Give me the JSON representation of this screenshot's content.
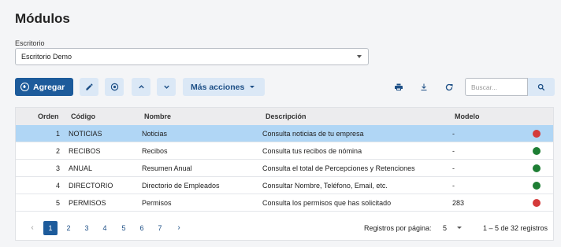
{
  "page": {
    "title": "Módulos"
  },
  "filter": {
    "label": "Escritorio",
    "value": "Escritorio Demo"
  },
  "toolbar": {
    "add_label": "Agregar",
    "more_label": "Más acciones",
    "search_placeholder": "Buscar..."
  },
  "table": {
    "headers": {
      "orden": "Orden",
      "codigo": "Código",
      "nombre": "Nombre",
      "descripcion": "Descripción",
      "modelo": "Modelo"
    },
    "rows": [
      {
        "orden": "1",
        "codigo": "NOTICIAS",
        "nombre": "Noticias",
        "descripcion": "Consulta noticias de tu empresa",
        "modelo": "-",
        "status": "red"
      },
      {
        "orden": "2",
        "codigo": "RECIBOS",
        "nombre": "Recibos",
        "descripcion": "Consulta tus recibos de nómina",
        "modelo": "-",
        "status": "green"
      },
      {
        "orden": "3",
        "codigo": "ANUAL",
        "nombre": "Resumen Anual",
        "descripcion": "Consulta el total de Percepciones y Retenciones",
        "modelo": "-",
        "status": "green"
      },
      {
        "orden": "4",
        "codigo": "DIRECTORIO",
        "nombre": "Directorio de Empleados",
        "descripcion": "Consultar Nombre, Teléfono, Email, etc.",
        "modelo": "-",
        "status": "green"
      },
      {
        "orden": "5",
        "codigo": "PERMISOS",
        "nombre": "Permisos",
        "descripcion": "Consulta los permisos que has solicitado",
        "modelo": "283",
        "status": "red"
      }
    ]
  },
  "colors": {
    "red": "#d43a3a",
    "green": "#1e7e34",
    "accent": "#1d5b9b",
    "selected_row": "#b0d6f5"
  },
  "pagination": {
    "pages": [
      "1",
      "2",
      "3",
      "4",
      "5",
      "6",
      "7"
    ],
    "current": "1",
    "per_page_label": "Registros por página:",
    "per_page_value": "5",
    "range_label": "1 – 5 de 32 registros"
  },
  "icons": [
    "plus-circle-icon",
    "pencil-icon",
    "cancel-circle-icon",
    "chevron-up-icon",
    "chevron-down-icon",
    "print-icon",
    "download-icon",
    "refresh-icon",
    "search-icon"
  ]
}
